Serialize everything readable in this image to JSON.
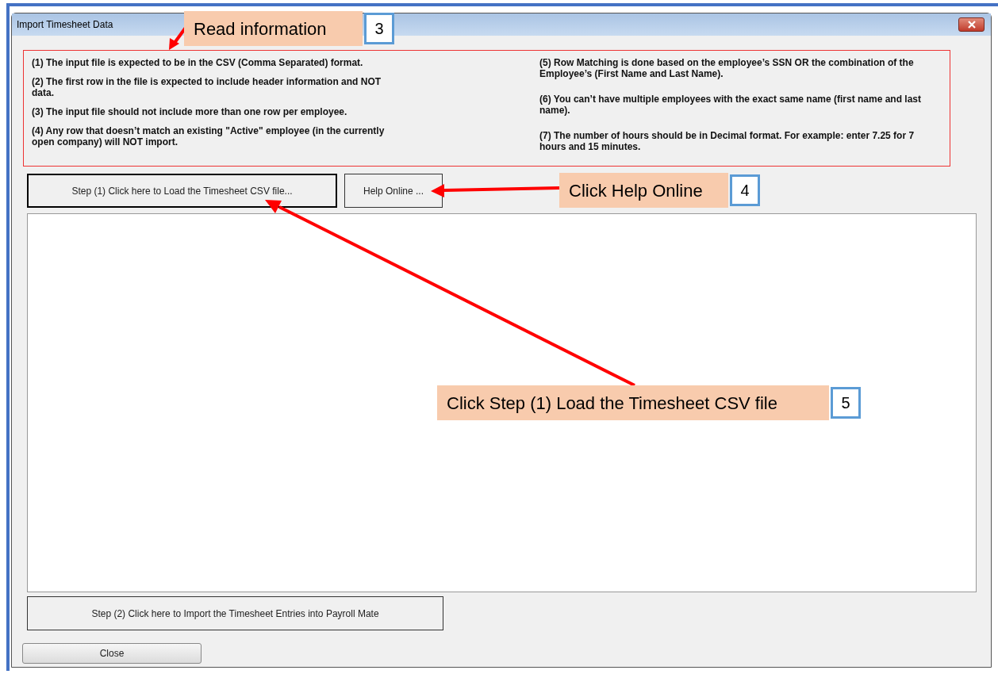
{
  "window": {
    "title": "Import Timesheet Data"
  },
  "notes_left": [
    "(1) The input file is expected to be in the CSV (Comma Separated) format.",
    "(2) The first row in the file is expected to include header information and NOT data.",
    "(3) The input file should not include more than one row per employee.",
    "(4) Any row that doesn’t match an existing \"Active\" employee (in the currently open company) will NOT import."
  ],
  "notes_right": [
    "(5) Row Matching is done based on the employee’s SSN OR the combination of the Employee’s (First Name and Last Name).",
    "(6)  You can’t have multiple employees with the exact same name (first name and last name).",
    "(7) The number of hours should be in Decimal format. For example: enter 7.25 for 7 hours and 15 minutes."
  ],
  "buttons": {
    "load": "Step (1) Click here to Load the Timesheet CSV file...",
    "help": "Help Online ...",
    "import": "Step (2) Click here to Import the Timesheet Entries into Payroll Mate",
    "close": "Close"
  },
  "callouts": [
    {
      "text": "Read information",
      "number": "3"
    },
    {
      "text": "Click Help Online",
      "number": "4"
    },
    {
      "text": "Click Step (1) Load the Timesheet CSV file",
      "number": "5"
    }
  ]
}
